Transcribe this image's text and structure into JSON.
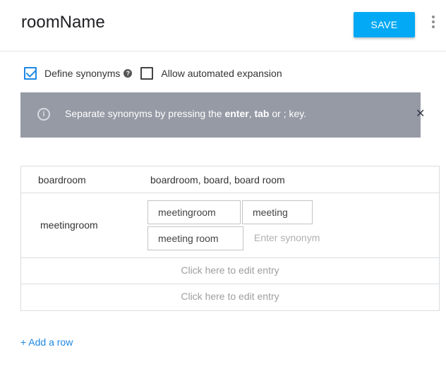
{
  "header": {
    "title": "roomName",
    "save_label": "SAVE",
    "more_icon": "more-vert-icon"
  },
  "options": {
    "define_synonyms": {
      "label": "Define synonyms",
      "checked": true
    },
    "help_icon": "?",
    "allow_expansion": {
      "label": "Allow automated expansion",
      "checked": false
    }
  },
  "banner": {
    "info_icon": "i",
    "text_before": "Separate synonyms by pressing the ",
    "key1": "enter",
    "sep1": ", ",
    "key2": "tab",
    "text_after": " or ; key.",
    "close_icon": "✕"
  },
  "entries": [
    {
      "reference": "boardroom",
      "synonyms_text": "boardroom, board, board room"
    },
    {
      "reference": "meetingroom",
      "chips": [
        "meetingroom",
        "meeting",
        "meeting room"
      ],
      "placeholder": "Enter synonym"
    }
  ],
  "empty_rows": [
    "Click here to edit entry",
    "Click here to edit entry"
  ],
  "add_row_label": "+ Add a row",
  "colors": {
    "accent": "#03a9f4",
    "link": "#1e88e5",
    "banner_bg": "#959aa5"
  }
}
